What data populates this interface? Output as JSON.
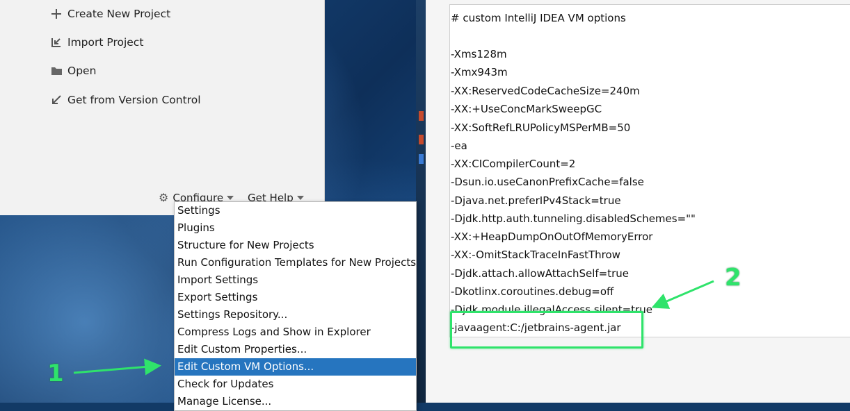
{
  "welcome": {
    "actions": [
      {
        "label": "Create New Project",
        "icon": "plus-icon"
      },
      {
        "label": "Import Project",
        "icon": "import-icon"
      },
      {
        "label": "Open",
        "icon": "folder-icon"
      },
      {
        "label": "Get from Version Control",
        "icon": "vcs-arrow-icon"
      }
    ],
    "configure_label": "Configure",
    "get_help_label": "Get Help"
  },
  "configure_menu": {
    "items": [
      "Settings",
      "Plugins",
      "Structure for New Projects",
      "Run Configuration Templates for New Projects",
      "Import Settings",
      "Export Settings",
      "Settings Repository...",
      "Compress Logs and Show in Explorer",
      "Edit Custom Properties...",
      "Edit Custom VM Options...",
      "Check for Updates",
      "Manage License..."
    ],
    "selected": "Edit Custom VM Options..."
  },
  "editor": {
    "lines": [
      "# custom IntelliJ IDEA VM options",
      "",
      "-Xms128m",
      "-Xmx943m",
      "-XX:ReservedCodeCacheSize=240m",
      "-XX:+UseConcMarkSweepGC",
      "-XX:SoftRefLRUPolicyMSPerMB=50",
      "-ea",
      "-XX:CICompilerCount=2",
      "-Dsun.io.useCanonPrefixCache=false",
      "-Djava.net.preferIPv4Stack=true",
      "-Djdk.http.auth.tunneling.disabledSchemes=\"\"",
      "-XX:+HeapDumpOnOutOfMemoryError",
      "-XX:-OmitStackTraceInFastThrow",
      "-Djdk.attach.allowAttachSelf=true",
      "-Dkotlinx.coroutines.debug=off",
      "-Djdk.module.illegalAccess.silent=true",
      "-javaagent:C:/jetbrains-agent.jar"
    ]
  },
  "annotations": {
    "step1": "1",
    "step2": "2",
    "accent_color": "#2fe36b"
  }
}
